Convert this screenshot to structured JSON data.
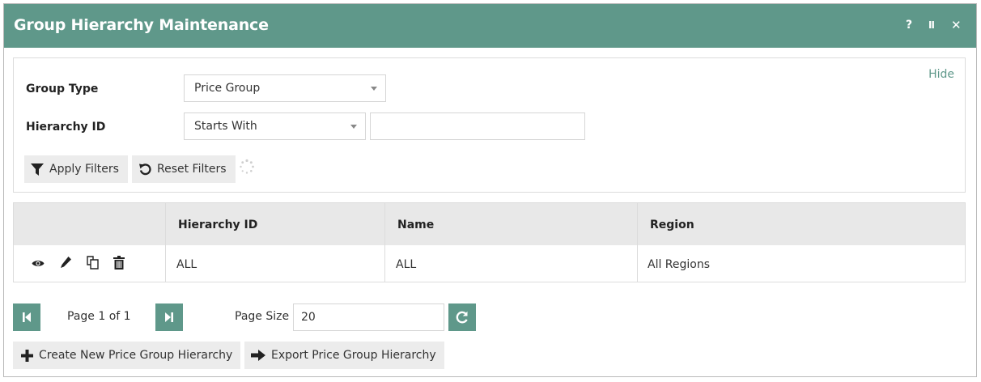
{
  "window": {
    "title": "Group Hierarchy Maintenance",
    "help_label": "?",
    "pause_label": "II",
    "close_label": "✕"
  },
  "filters": {
    "hide_label": "Hide",
    "group_type_label": "Group Type",
    "group_type_value": "Price Group",
    "hierarchy_id_label": "Hierarchy ID",
    "hierarchy_id_operator": "Starts With",
    "hierarchy_id_value": "",
    "apply_label": "Apply Filters",
    "reset_label": "Reset Filters"
  },
  "table": {
    "columns": [
      "",
      "Hierarchy ID",
      "Name",
      "Region"
    ],
    "rows": [
      {
        "hierarchy_id": "ALL",
        "name": "ALL",
        "region": "All Regions"
      }
    ]
  },
  "pager": {
    "page_text": "Page 1 of 1",
    "page_size_label": "Page Size",
    "page_size_value": "20"
  },
  "actions": {
    "create_label": "Create New Price Group Hierarchy",
    "export_label": "Export Price Group Hierarchy"
  },
  "colors": {
    "accent": "#5f988a",
    "header_bg": "#e8e8e8",
    "button_bg": "#ececec"
  }
}
